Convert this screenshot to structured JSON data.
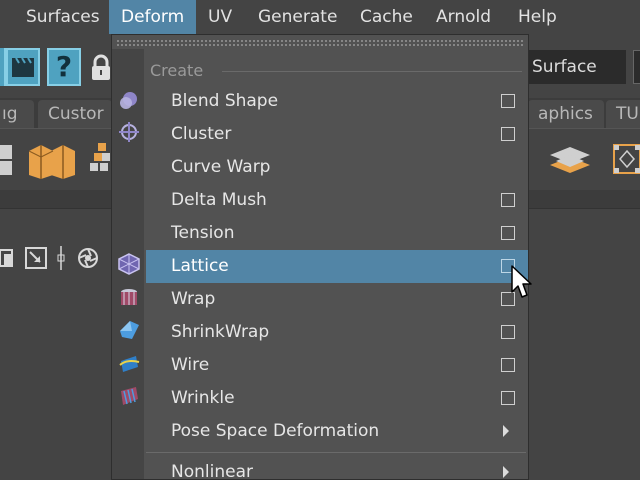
{
  "menubar": {
    "items": [
      "Surfaces",
      "Deform",
      "UV",
      "Generate",
      "Cache",
      "Arnold",
      "Help"
    ],
    "active": "Deform"
  },
  "status_line": {
    "surface_field": "Surface"
  },
  "shelf_tabs": [
    "ıg",
    "Custor",
    "aphics",
    "TU"
  ],
  "menu": {
    "section": "Create",
    "items": [
      {
        "label": "Blend Shape",
        "option_box": true
      },
      {
        "label": "Cluster",
        "option_box": true
      },
      {
        "label": "Curve Warp",
        "option_box": false
      },
      {
        "label": "Delta Mush",
        "option_box": true
      },
      {
        "label": "Tension",
        "option_box": true
      },
      {
        "label": "Lattice",
        "option_box": true,
        "highlighted": true
      },
      {
        "label": "Wrap",
        "option_box": true
      },
      {
        "label": "ShrinkWrap",
        "option_box": true
      },
      {
        "label": "Wire",
        "option_box": true
      },
      {
        "label": "Wrinkle",
        "option_box": true
      },
      {
        "label": "Pose Space Deformation",
        "submenu": true
      },
      {
        "label": "Nonlinear",
        "submenu": true
      }
    ]
  },
  "colors": {
    "highlight": "#5285a6",
    "menu_bg": "#525252",
    "app_bg": "#444444",
    "tool_accent": "#4fa2c0"
  },
  "icons": {
    "gutter": [
      "blend-shape-icon",
      "cluster-icon",
      "lattice-icon",
      "wrap-icon",
      "shrinkwrap-icon",
      "wire-icon",
      "wrinkle-icon"
    ],
    "toolbar": [
      "clapper-icon",
      "question-icon",
      "lock-icon"
    ],
    "shelf": [
      "cube-split-icon",
      "cube-stack-icon",
      "plane-stack-icon",
      "lattice-box-icon"
    ]
  }
}
